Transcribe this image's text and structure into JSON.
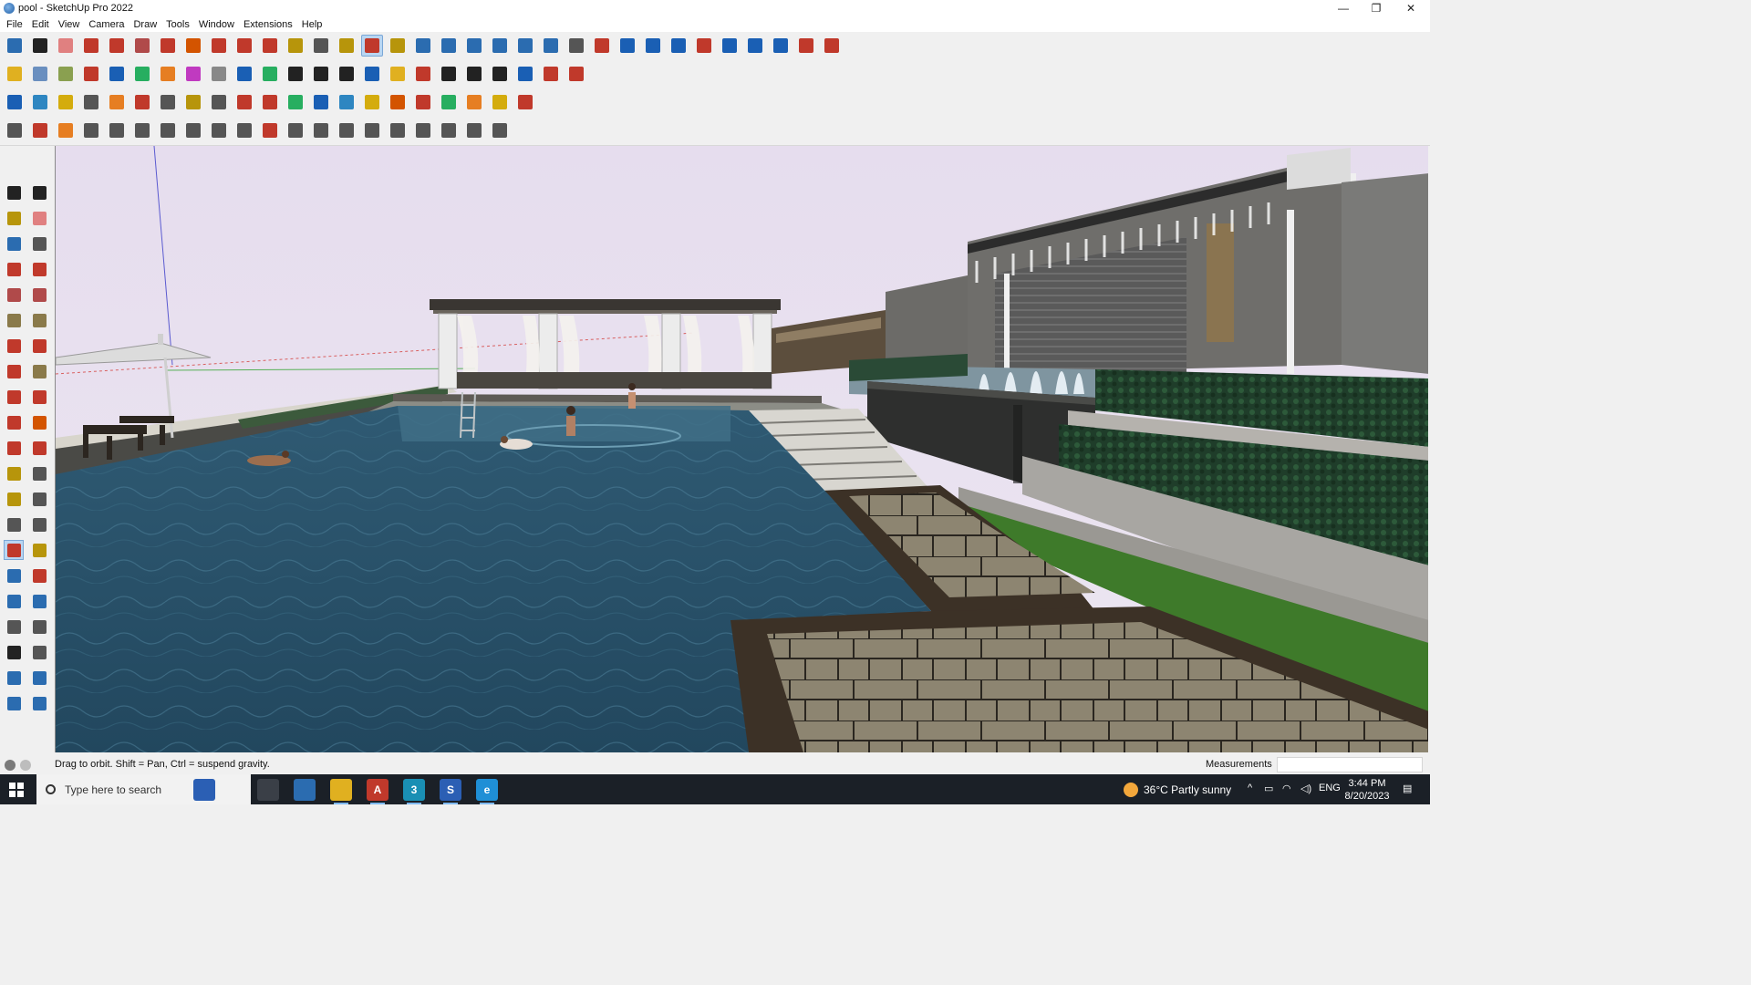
{
  "window": {
    "title": "pool - SketchUp Pro 2022",
    "controls": {
      "minimize": "—",
      "maximize": "❐",
      "close": "✕"
    }
  },
  "menu": [
    "File",
    "Edit",
    "View",
    "Camera",
    "Draw",
    "Tools",
    "Window",
    "Extensions",
    "Help"
  ],
  "toolbars": {
    "row1": [
      {
        "icon": "zoom-extents-icon",
        "color": "#2b6cb0"
      },
      {
        "icon": "select-icon",
        "color": "#222222"
      },
      {
        "icon": "eraser-icon",
        "color": "#e08080"
      },
      {
        "icon": "line-icon",
        "color": "#c0392b"
      },
      {
        "icon": "arc-icon",
        "color": "#c0392b"
      },
      {
        "icon": "rectangle-icon",
        "color": "#b04a4a"
      },
      {
        "icon": "push-pull-icon",
        "color": "#c0392b"
      },
      {
        "icon": "follow-me-icon",
        "color": "#d35400"
      },
      {
        "icon": "move-icon",
        "color": "#c0392b"
      },
      {
        "icon": "rotate-icon",
        "color": "#c0392b"
      },
      {
        "icon": "scale-icon",
        "color": "#c0392b"
      },
      {
        "icon": "tape-measure-icon",
        "color": "#b7950b"
      },
      {
        "icon": "text-icon",
        "color": "#555555"
      },
      {
        "icon": "paint-bucket-icon",
        "color": "#b7950b"
      },
      {
        "icon": "orbit-icon",
        "color": "#c0392b",
        "active": true
      },
      {
        "icon": "pan-icon",
        "color": "#b7950b"
      },
      {
        "icon": "zoom-icon",
        "color": "#2b6cb0"
      },
      {
        "icon": "zoom-window-icon",
        "color": "#2b6cb0"
      },
      {
        "icon": "previous-view-icon",
        "color": "#2b6cb0"
      },
      {
        "icon": "section-plane-icon",
        "color": "#2b6cb0"
      },
      {
        "icon": "layers-icon",
        "color": "#2b6cb0"
      },
      {
        "icon": "sandbox-icon",
        "color": "#2b6cb0"
      },
      {
        "icon": "warehouse-icon",
        "color": "#555555"
      },
      {
        "icon": "extension-manager-icon",
        "color": "#c0392b"
      },
      {
        "icon": "component-icon",
        "color": "#1a5fb4"
      },
      {
        "icon": "axis-icon",
        "color": "#1a5fb4"
      },
      {
        "icon": "flip-icon",
        "color": "#1a5fb4"
      },
      {
        "icon": "mirror-icon",
        "color": "#c0392b"
      },
      {
        "icon": "align-icon",
        "color": "#1a5fb4"
      },
      {
        "icon": "distribute-icon",
        "color": "#1a5fb4"
      },
      {
        "icon": "undo-icon",
        "color": "#1a5fb4"
      },
      {
        "icon": "redo-icon",
        "color": "#c0392b"
      },
      {
        "icon": "hand-icon",
        "color": "#c0392b"
      }
    ],
    "row2": [
      {
        "icon": "box-yellow-icon",
        "color": "#e0b020"
      },
      {
        "icon": "box-wire-icon",
        "color": "#6a8fbf"
      },
      {
        "icon": "box-shaded-icon",
        "color": "#8aa050"
      },
      {
        "icon": "arrow-red-icon",
        "color": "#c0392b"
      },
      {
        "icon": "arrow-blue-icon",
        "color": "#1a5fb4"
      },
      {
        "icon": "arrow-green-icon",
        "color": "#27ae60"
      },
      {
        "icon": "arrow-orange-icon",
        "color": "#e67e22"
      },
      {
        "icon": "arrow-magenta-icon",
        "color": "#c03ac0"
      },
      {
        "icon": "curve-icon",
        "color": "#888888"
      },
      {
        "icon": "stair-icon",
        "color": "#1a5fb4"
      },
      {
        "icon": "roof-icon",
        "color": "#27ae60"
      },
      {
        "icon": "house-icon",
        "color": "#222222"
      },
      {
        "icon": "window-icon",
        "color": "#222222"
      },
      {
        "icon": "door-icon",
        "color": "#222222"
      },
      {
        "icon": "fx-icon",
        "color": "#1a5fb4"
      },
      {
        "icon": "glue-icon",
        "color": "#e0b020"
      },
      {
        "icon": "pencil-red-icon",
        "color": "#c0392b"
      },
      {
        "icon": "circle-shape-icon",
        "color": "#222222"
      },
      {
        "icon": "polygon-shape-icon",
        "color": "#222222"
      },
      {
        "icon": "ellipse-shape-icon",
        "color": "#222222"
      },
      {
        "icon": "spline-icon",
        "color": "#1a5fb4"
      },
      {
        "icon": "weld-icon",
        "color": "#c0392b"
      },
      {
        "icon": "fillet-icon",
        "color": "#c0392b"
      }
    ],
    "row3": [
      {
        "icon": "plane-blue-icon",
        "color": "#1a5fb4"
      },
      {
        "icon": "plane-cyan-icon",
        "color": "#2e86c1"
      },
      {
        "icon": "plane-yellow-icon",
        "color": "#d4ac0d"
      },
      {
        "icon": "text-label-icon",
        "color": "#555555"
      },
      {
        "icon": "loop-icon",
        "color": "#e67e22"
      },
      {
        "icon": "square-red-icon",
        "color": "#c0392b"
      },
      {
        "icon": "grid-icon",
        "color": "#555555"
      },
      {
        "icon": "book-icon",
        "color": "#b7950b"
      },
      {
        "icon": "chain-icon",
        "color": "#555555"
      },
      {
        "icon": "dots-curve-icon",
        "color": "#c0392b"
      },
      {
        "icon": "plus-red-icon",
        "color": "#c0392b"
      },
      {
        "icon": "plus-green-icon",
        "color": "#27ae60"
      },
      {
        "icon": "x-blue-icon",
        "color": "#1a5fb4"
      },
      {
        "icon": "cone-icon",
        "color": "#2e86c1"
      },
      {
        "icon": "triangle-icon",
        "color": "#d4ac0d"
      },
      {
        "icon": "spiral-icon",
        "color": "#d35400"
      },
      {
        "icon": "magnet-icon",
        "color": "#c0392b"
      },
      {
        "icon": "tree-icon",
        "color": "#27ae60"
      },
      {
        "icon": "crate-icon",
        "color": "#e67e22"
      },
      {
        "icon": "tile-icon",
        "color": "#d4ac0d"
      },
      {
        "icon": "scatter-icon",
        "color": "#c0392b"
      }
    ],
    "row4": [
      {
        "icon": "transform-icon",
        "color": "#555555"
      },
      {
        "icon": "path-icon",
        "color": "#c0392b"
      },
      {
        "icon": "offset-icon",
        "color": "#e67e22"
      },
      {
        "icon": "shape-a-icon",
        "color": "#555555"
      },
      {
        "icon": "shape-b-icon",
        "color": "#555555"
      },
      {
        "icon": "shape-c-icon",
        "color": "#555555"
      },
      {
        "icon": "shape-d-icon",
        "color": "#555555"
      },
      {
        "icon": "shape-e-icon",
        "color": "#555555"
      },
      {
        "icon": "shape-f-icon",
        "color": "#555555"
      },
      {
        "icon": "shape-g-icon",
        "color": "#555555"
      },
      {
        "icon": "shape-h-icon",
        "color": "#c0392b"
      },
      {
        "icon": "shape-i-icon",
        "color": "#555555"
      },
      {
        "icon": "shape-j-icon",
        "color": "#555555"
      },
      {
        "icon": "shape-k-icon",
        "color": "#555555"
      },
      {
        "icon": "shape-l-icon",
        "color": "#555555"
      },
      {
        "icon": "shape-m-icon",
        "color": "#555555"
      },
      {
        "icon": "shape-n-icon",
        "color": "#555555"
      },
      {
        "icon": "shape-o-icon",
        "color": "#555555"
      },
      {
        "icon": "shape-p-icon",
        "color": "#555555"
      },
      {
        "icon": "shape-q-icon",
        "color": "#555555"
      }
    ]
  },
  "palette": [
    {
      "icon": "select-arrow-icon",
      "color": "#222222"
    },
    {
      "icon": "make-component-icon",
      "color": "#222222"
    },
    {
      "icon": "paint-icon",
      "color": "#b7950b"
    },
    {
      "icon": "erase-icon",
      "color": "#e08080"
    },
    {
      "icon": "axes-tool-icon",
      "color": "#2b6cb0"
    },
    {
      "icon": "measure-icon",
      "color": "#555555"
    },
    {
      "icon": "line-tool-icon",
      "color": "#c0392b"
    },
    {
      "icon": "freehand-icon",
      "color": "#c0392b"
    },
    {
      "icon": "rect-tool-icon",
      "color": "#b04a4a"
    },
    {
      "icon": "rotated-rect-icon",
      "color": "#b04a4a"
    },
    {
      "icon": "circle-tool-icon",
      "color": "#8a7a4a"
    },
    {
      "icon": "polygon-tool-icon",
      "color": "#8a7a4a"
    },
    {
      "icon": "arc-tool-icon",
      "color": "#c0392b"
    },
    {
      "icon": "arc2-tool-icon",
      "color": "#c0392b"
    },
    {
      "icon": "arc3-tool-icon",
      "color": "#c0392b"
    },
    {
      "icon": "pie-tool-icon",
      "color": "#8a7a4a"
    },
    {
      "icon": "move-tool-icon",
      "color": "#c0392b"
    },
    {
      "icon": "pushpull-tool-icon",
      "color": "#c0392b"
    },
    {
      "icon": "rotate-tool-icon",
      "color": "#c0392b"
    },
    {
      "icon": "followme-tool-icon",
      "color": "#d35400"
    },
    {
      "icon": "scale-tool-icon",
      "color": "#c0392b"
    },
    {
      "icon": "offset-tool-icon",
      "color": "#c0392b"
    },
    {
      "icon": "tape-tool-icon",
      "color": "#b7950b"
    },
    {
      "icon": "dimension-tool-icon",
      "color": "#555555"
    },
    {
      "icon": "protractor-tool-icon",
      "color": "#b7950b"
    },
    {
      "icon": "text-tool-icon",
      "color": "#555555"
    },
    {
      "icon": "axes2-tool-icon",
      "color": "#555555"
    },
    {
      "icon": "3dtext-tool-icon",
      "color": "#555555"
    },
    {
      "icon": "orbit-tool-icon",
      "color": "#c0392b",
      "active": true
    },
    {
      "icon": "pan-tool-icon",
      "color": "#b7950b"
    },
    {
      "icon": "zoom-tool-icon",
      "color": "#2b6cb0"
    },
    {
      "icon": "zoomwin-tool-icon",
      "color": "#c0392b"
    },
    {
      "icon": "zoomext-tool-icon",
      "color": "#2b6cb0"
    },
    {
      "icon": "prevview-tool-icon",
      "color": "#2b6cb0"
    },
    {
      "icon": "walk-tool-icon",
      "color": "#555555"
    },
    {
      "icon": "lookaround-tool-icon",
      "color": "#555555"
    },
    {
      "icon": "footprint-tool-icon",
      "color": "#222222"
    },
    {
      "icon": "position-camera-icon",
      "color": "#555555"
    },
    {
      "icon": "section-tool-icon",
      "color": "#2b6cb0"
    },
    {
      "icon": "section2-tool-icon",
      "color": "#2b6cb0"
    },
    {
      "icon": "sandbox-tool-icon",
      "color": "#2b6cb0"
    },
    {
      "icon": "sandbox2-tool-icon",
      "color": "#2b6cb0"
    }
  ],
  "status": {
    "hint": "Drag to orbit. Shift = Pan, Ctrl = suspend gravity.",
    "measurements_label": "Measurements",
    "measurements_value": ""
  },
  "taskbar": {
    "search_placeholder": "Type here to search",
    "apps": [
      {
        "icon": "widgets-icon",
        "label": "",
        "color": "#2b5fb4"
      },
      {
        "icon": "task-view-icon",
        "label": "",
        "color": "#3a3f47"
      },
      {
        "icon": "calculator-icon",
        "label": "",
        "color": "#2b6cb0"
      },
      {
        "icon": "file-explorer-icon",
        "label": "",
        "color": "#e0b020"
      },
      {
        "icon": "acrobat-icon",
        "label": "A",
        "color": "#c0392b"
      },
      {
        "icon": "sketchup-3-icon",
        "label": "3",
        "color": "#1a8fb4"
      },
      {
        "icon": "sketchup-icon",
        "label": "S",
        "color": "#2b5fb4"
      },
      {
        "icon": "edge-icon",
        "label": "e",
        "color": "#1f8fd6"
      }
    ],
    "weather": "36°C  Partly sunny",
    "language": "ENG",
    "time": "3:44 PM",
    "date": "8/20/2023"
  }
}
